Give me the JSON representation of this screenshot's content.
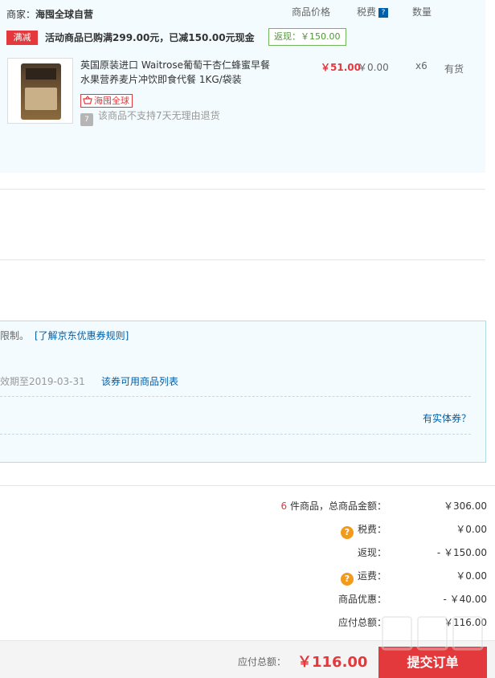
{
  "shop": {
    "merchant_label": "商家：",
    "merchant_name": "海囤全球自营",
    "col_price": "商品价格",
    "col_tax": "税费",
    "col_tax_help": "?",
    "col_qty": "数量",
    "promo_tag": "满减",
    "promo_text": "活动商品已购满299.00元，已减150.00元现金",
    "cashback": "返现：￥150.00"
  },
  "item": {
    "title": "英国原装进口 Waitrose葡萄干杏仁蜂蜜早餐水果营养麦片冲饮即食代餐 1KG/袋装",
    "badge": "海囤全球",
    "no_return_icon": "7",
    "no_return": "该商品不支持7天无理由退货",
    "price": "￥51.00",
    "tax": "￥0.00",
    "qty": "x6",
    "stock": "有货"
  },
  "coupon": {
    "limit_text": "限制。",
    "rule_link": "[了解京东优惠券规则]",
    "expiry": "效期至2019-03-31",
    "list_link": "该券可用商品列表",
    "physical_link": "有实体券？"
  },
  "summary": {
    "count": "6",
    "total_label": " 件商品，总商品金额：",
    "total_value": "￥306.00",
    "tax_label": "税费：",
    "tax_value": "￥0.00",
    "cashback_label": "返现：",
    "cashback_value": "- ￥150.00",
    "shipping_label": "运费：",
    "shipping_value": "￥0.00",
    "discount_label": "商品优惠：",
    "discount_value": "- ￥40.00",
    "due_label": "应付总额：",
    "due_value": "￥116.00",
    "help": "?"
  },
  "footer": {
    "pay_label": "应付总额：",
    "pay_amount": "￥116.00",
    "submit": "提交订单"
  },
  "colors": {
    "accent_red": "#e4393c",
    "link_blue": "#005ea7",
    "panel_bg": "#f3fbfe",
    "cashback_green": "#4a9b2f",
    "help_orange": "#f29b1b"
  },
  "icons": [
    "help-icon",
    "shopping-basket-icon",
    "seven-day-return-icon"
  ]
}
